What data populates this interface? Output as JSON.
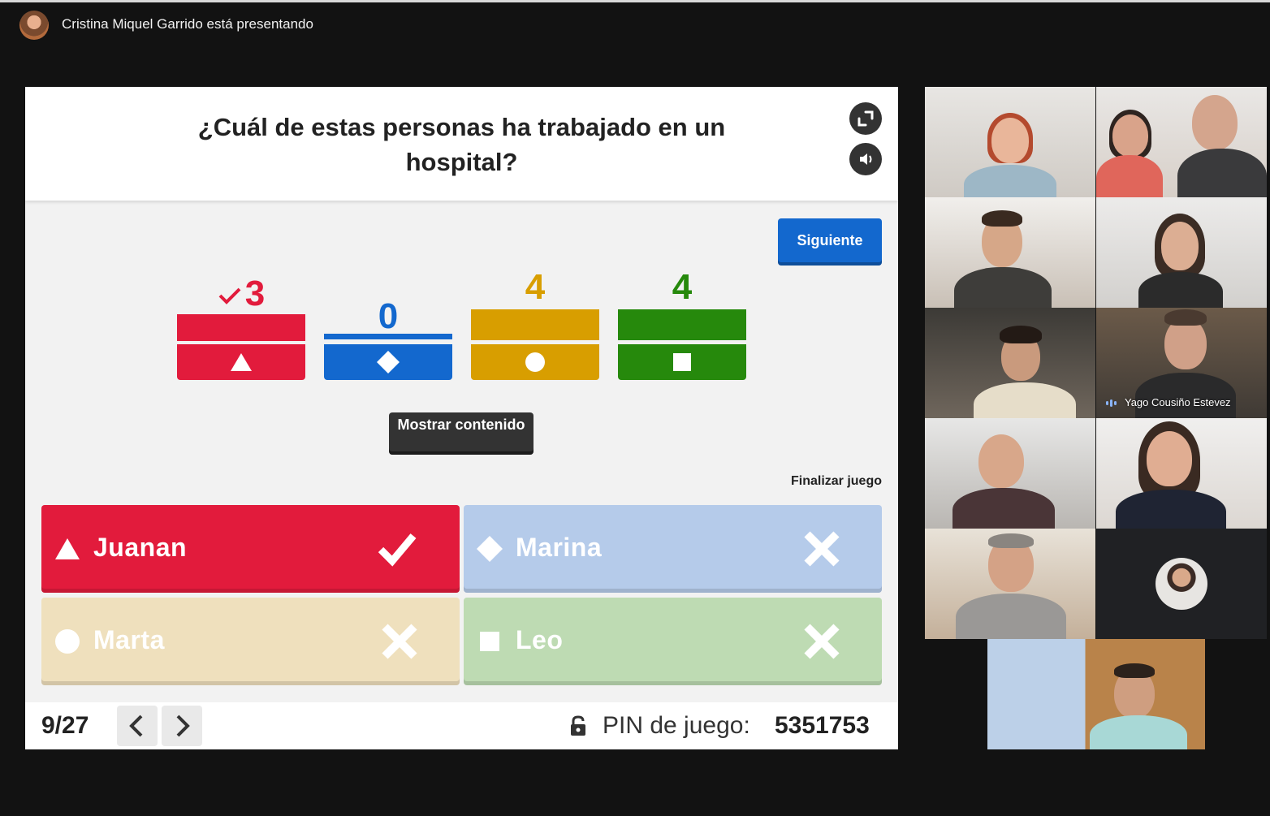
{
  "meeting": {
    "presenter_text": "Cristina Miquel Garrido está presentando"
  },
  "quiz": {
    "question": "¿Cuál de estas personas ha trabajado en un hospital?",
    "next_label": "Siguiente",
    "show_content_label": "Mostrar contenido",
    "end_game_label": "Finalizar juego",
    "results": [
      {
        "shape": "triangle-icon",
        "count": "3",
        "correct": true,
        "color": "#e21b3c"
      },
      {
        "shape": "diamond-icon",
        "count": "0",
        "correct": false,
        "color": "#1368ce"
      },
      {
        "shape": "circle-icon",
        "count": "4",
        "correct": false,
        "color": "#d89e00"
      },
      {
        "shape": "square-icon",
        "count": "4",
        "correct": false,
        "color": "#26890c"
      }
    ],
    "answers": [
      {
        "shape": "triangle-icon",
        "name": "Juanan",
        "correct": true,
        "color": "#e21b3c"
      },
      {
        "shape": "diamond-icon",
        "name": "Marina",
        "correct": false,
        "color": "#b5cbea"
      },
      {
        "shape": "circle-icon",
        "name": "Marta",
        "correct": false,
        "color": "#efe0bd"
      },
      {
        "shape": "square-icon",
        "name": "Leo",
        "correct": false,
        "color": "#bedbb3"
      }
    ],
    "progress": "9/27",
    "pin_label": "PIN de juego:",
    "pin_value": "5351753"
  },
  "participants": [
    {
      "name": ""
    },
    {
      "name": ""
    },
    {
      "name": ""
    },
    {
      "name": ""
    },
    {
      "name": ""
    },
    {
      "name": "Yago Cousiño Estevez"
    },
    {
      "name": ""
    },
    {
      "name": ""
    },
    {
      "name": ""
    },
    {
      "name": ""
    },
    {
      "name": ""
    }
  ]
}
